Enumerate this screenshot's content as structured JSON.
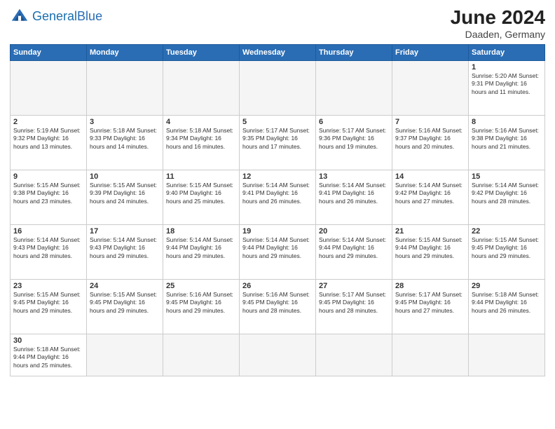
{
  "header": {
    "logo_general": "General",
    "logo_blue": "Blue",
    "month_year": "June 2024",
    "location": "Daaden, Germany"
  },
  "weekdays": [
    "Sunday",
    "Monday",
    "Tuesday",
    "Wednesday",
    "Thursday",
    "Friday",
    "Saturday"
  ],
  "weeks": [
    [
      {
        "day": "",
        "info": "",
        "empty": true
      },
      {
        "day": "",
        "info": "",
        "empty": true
      },
      {
        "day": "",
        "info": "",
        "empty": true
      },
      {
        "day": "",
        "info": "",
        "empty": true
      },
      {
        "day": "",
        "info": "",
        "empty": true
      },
      {
        "day": "",
        "info": "",
        "empty": true
      },
      {
        "day": "1",
        "info": "Sunrise: 5:20 AM\nSunset: 9:31 PM\nDaylight: 16 hours\nand 11 minutes."
      }
    ],
    [
      {
        "day": "2",
        "info": "Sunrise: 5:19 AM\nSunset: 9:32 PM\nDaylight: 16 hours\nand 13 minutes."
      },
      {
        "day": "3",
        "info": "Sunrise: 5:18 AM\nSunset: 9:33 PM\nDaylight: 16 hours\nand 14 minutes."
      },
      {
        "day": "4",
        "info": "Sunrise: 5:18 AM\nSunset: 9:34 PM\nDaylight: 16 hours\nand 16 minutes."
      },
      {
        "day": "5",
        "info": "Sunrise: 5:17 AM\nSunset: 9:35 PM\nDaylight: 16 hours\nand 17 minutes."
      },
      {
        "day": "6",
        "info": "Sunrise: 5:17 AM\nSunset: 9:36 PM\nDaylight: 16 hours\nand 19 minutes."
      },
      {
        "day": "7",
        "info": "Sunrise: 5:16 AM\nSunset: 9:37 PM\nDaylight: 16 hours\nand 20 minutes."
      },
      {
        "day": "8",
        "info": "Sunrise: 5:16 AM\nSunset: 9:38 PM\nDaylight: 16 hours\nand 21 minutes."
      }
    ],
    [
      {
        "day": "9",
        "info": "Sunrise: 5:15 AM\nSunset: 9:38 PM\nDaylight: 16 hours\nand 23 minutes."
      },
      {
        "day": "10",
        "info": "Sunrise: 5:15 AM\nSunset: 9:39 PM\nDaylight: 16 hours\nand 24 minutes."
      },
      {
        "day": "11",
        "info": "Sunrise: 5:15 AM\nSunset: 9:40 PM\nDaylight: 16 hours\nand 25 minutes."
      },
      {
        "day": "12",
        "info": "Sunrise: 5:14 AM\nSunset: 9:41 PM\nDaylight: 16 hours\nand 26 minutes."
      },
      {
        "day": "13",
        "info": "Sunrise: 5:14 AM\nSunset: 9:41 PM\nDaylight: 16 hours\nand 26 minutes."
      },
      {
        "day": "14",
        "info": "Sunrise: 5:14 AM\nSunset: 9:42 PM\nDaylight: 16 hours\nand 27 minutes."
      },
      {
        "day": "15",
        "info": "Sunrise: 5:14 AM\nSunset: 9:42 PM\nDaylight: 16 hours\nand 28 minutes."
      }
    ],
    [
      {
        "day": "16",
        "info": "Sunrise: 5:14 AM\nSunset: 9:43 PM\nDaylight: 16 hours\nand 28 minutes."
      },
      {
        "day": "17",
        "info": "Sunrise: 5:14 AM\nSunset: 9:43 PM\nDaylight: 16 hours\nand 29 minutes."
      },
      {
        "day": "18",
        "info": "Sunrise: 5:14 AM\nSunset: 9:44 PM\nDaylight: 16 hours\nand 29 minutes."
      },
      {
        "day": "19",
        "info": "Sunrise: 5:14 AM\nSunset: 9:44 PM\nDaylight: 16 hours\nand 29 minutes."
      },
      {
        "day": "20",
        "info": "Sunrise: 5:14 AM\nSunset: 9:44 PM\nDaylight: 16 hours\nand 29 minutes."
      },
      {
        "day": "21",
        "info": "Sunrise: 5:15 AM\nSunset: 9:44 PM\nDaylight: 16 hours\nand 29 minutes."
      },
      {
        "day": "22",
        "info": "Sunrise: 5:15 AM\nSunset: 9:45 PM\nDaylight: 16 hours\nand 29 minutes."
      }
    ],
    [
      {
        "day": "23",
        "info": "Sunrise: 5:15 AM\nSunset: 9:45 PM\nDaylight: 16 hours\nand 29 minutes."
      },
      {
        "day": "24",
        "info": "Sunrise: 5:15 AM\nSunset: 9:45 PM\nDaylight: 16 hours\nand 29 minutes."
      },
      {
        "day": "25",
        "info": "Sunrise: 5:16 AM\nSunset: 9:45 PM\nDaylight: 16 hours\nand 29 minutes."
      },
      {
        "day": "26",
        "info": "Sunrise: 5:16 AM\nSunset: 9:45 PM\nDaylight: 16 hours\nand 28 minutes."
      },
      {
        "day": "27",
        "info": "Sunrise: 5:17 AM\nSunset: 9:45 PM\nDaylight: 16 hours\nand 28 minutes."
      },
      {
        "day": "28",
        "info": "Sunrise: 5:17 AM\nSunset: 9:45 PM\nDaylight: 16 hours\nand 27 minutes."
      },
      {
        "day": "29",
        "info": "Sunrise: 5:18 AM\nSunset: 9:44 PM\nDaylight: 16 hours\nand 26 minutes."
      }
    ],
    [
      {
        "day": "30",
        "info": "Sunrise: 5:18 AM\nSunset: 9:44 PM\nDaylight: 16 hours\nand 25 minutes.",
        "lastrow": true
      },
      {
        "day": "",
        "info": "",
        "empty": true,
        "lastrow": true
      },
      {
        "day": "",
        "info": "",
        "empty": true,
        "lastrow": true
      },
      {
        "day": "",
        "info": "",
        "empty": true,
        "lastrow": true
      },
      {
        "day": "",
        "info": "",
        "empty": true,
        "lastrow": true
      },
      {
        "day": "",
        "info": "",
        "empty": true,
        "lastrow": true
      },
      {
        "day": "",
        "info": "",
        "empty": true,
        "lastrow": true
      }
    ]
  ]
}
